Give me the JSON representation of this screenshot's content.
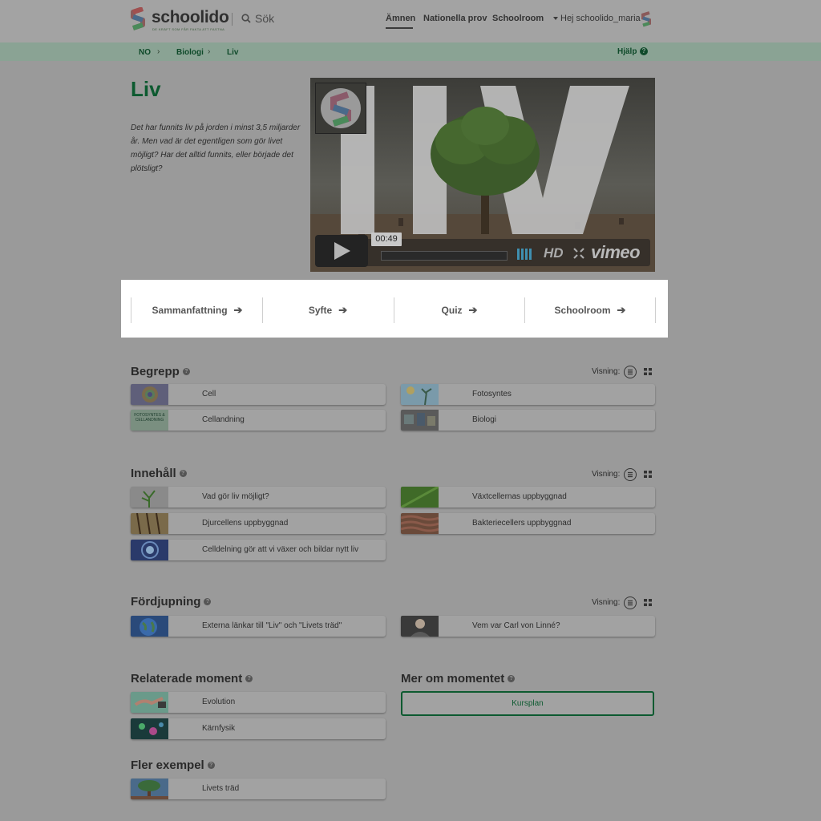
{
  "header": {
    "logo_text": "schoolido",
    "logo_tagline": "DE KRÄFT SOM FÅR FAKTA ATT FASTNA",
    "search_label": "Sök",
    "nav": [
      {
        "label": "Ämnen",
        "active": true
      },
      {
        "label": "Nationella prov",
        "active": false
      },
      {
        "label": "Schoolroom",
        "active": false
      }
    ],
    "user_greeting": "Hej schoolido_maria"
  },
  "breadcrumb": {
    "items": [
      "NO",
      "Biologi",
      "Liv"
    ],
    "separator": "›",
    "help_label": "Hjälp",
    "help_icon": "question-circle-icon"
  },
  "page": {
    "title": "Liv",
    "intro": "Det har funnits liv på jorden i minst 3,5 miljarder år. Men vad är det egentligen som gör livet möjligt? Har det alltid funnits, eller började det plötsligt?"
  },
  "video": {
    "overlay_text": "LIV",
    "time": "00:49",
    "hd_label": "HD",
    "provider": "vimeo"
  },
  "actions": [
    {
      "label": "Sammanfattning",
      "icon": "arrow-right-icon"
    },
    {
      "label": "Syfte",
      "icon": "arrow-right-icon"
    },
    {
      "label": "Quiz",
      "icon": "arrow-right-icon"
    },
    {
      "label": "Schoolroom",
      "icon": "arrow-right-icon"
    }
  ],
  "view_label": "Visning:",
  "sections": {
    "begrepp": {
      "title": "Begrepp",
      "items": [
        "Cell",
        "Fotosyntes",
        "Cellandning",
        "Biologi"
      ],
      "thumb_text": [
        "FOTOSYNTES & CELLANDNING"
      ]
    },
    "innehall": {
      "title": "Innehåll",
      "items": [
        "Vad gör liv möjligt?",
        "Växtcellernas uppbyggnad",
        "Djurcellens uppbyggnad",
        "Bakteriecellers uppbyggnad",
        "Celldelning gör att vi växer och bildar nytt liv"
      ]
    },
    "fordjupning": {
      "title": "Fördjupning",
      "items": [
        "Externa länkar till \"Liv\" och \"Livets träd\"",
        "Vem var Carl von Linné?"
      ]
    },
    "relaterade": {
      "title": "Relaterade moment",
      "items": [
        "Evolution",
        "Kärnfysik"
      ]
    },
    "mer_om": {
      "title": "Mer om momentet",
      "button_label": "Kursplan"
    },
    "fler_exempel": {
      "title": "Fler exempel",
      "items": [
        "Livets träd"
      ]
    }
  },
  "colors": {
    "brand_green": "#0d5a30",
    "highlight_panel": "#ffffff",
    "dim_overlay": "#9a9a9a"
  }
}
